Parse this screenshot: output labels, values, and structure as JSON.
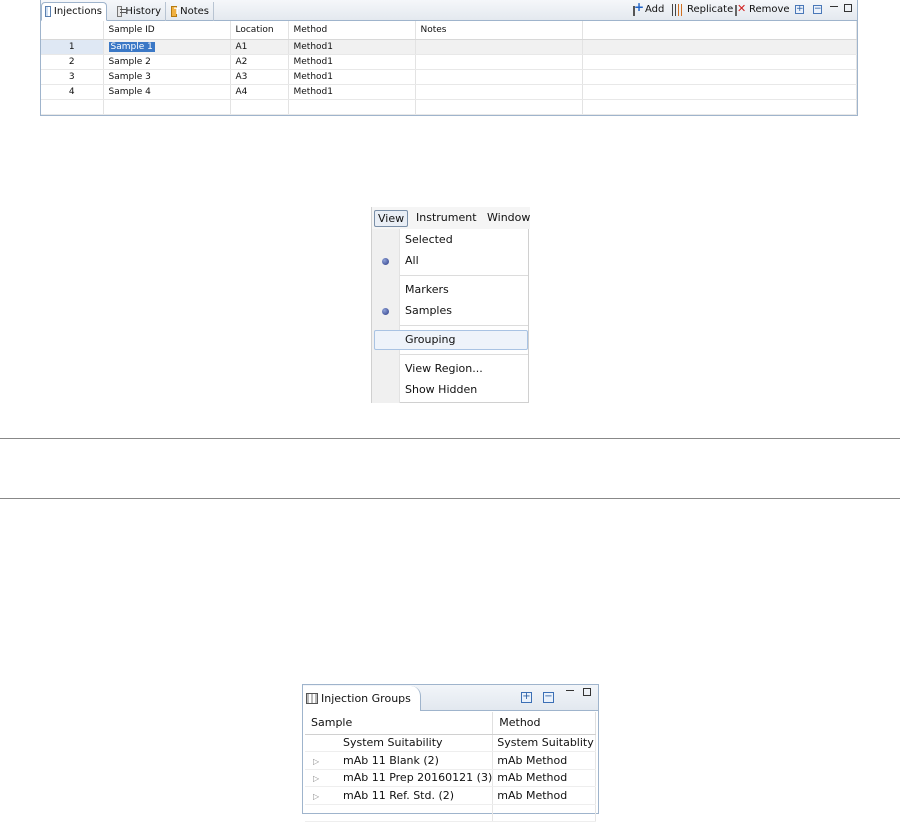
{
  "injections_panel": {
    "tabs": [
      {
        "label": "Injections",
        "icon": "table-icon"
      },
      {
        "label": "History",
        "icon": "history-icon"
      },
      {
        "label": "Notes",
        "icon": "notes-icon"
      }
    ],
    "toolbar": {
      "add": "Add",
      "replicate": "Replicate",
      "remove": "Remove",
      "expand": "+",
      "collapse": "−"
    },
    "columns": [
      "",
      "Sample ID",
      "Location",
      "Method",
      "Notes"
    ],
    "rows": [
      {
        "num": "1",
        "sample_id": "Sample 1",
        "location": "A1",
        "method": "Method1",
        "notes": ""
      },
      {
        "num": "2",
        "sample_id": "Sample 2",
        "location": "A2",
        "method": "Method1",
        "notes": ""
      },
      {
        "num": "3",
        "sample_id": "Sample 3",
        "location": "A3",
        "method": "Method1",
        "notes": ""
      },
      {
        "num": "4",
        "sample_id": "Sample 4",
        "location": "A4",
        "method": "Method1",
        "notes": ""
      }
    ]
  },
  "view_menu": {
    "menubar": [
      "View",
      "Instrument",
      "Window"
    ],
    "items": {
      "selected": "Selected",
      "all": "All",
      "markers": "Markers",
      "samples": "Samples",
      "grouping": "Grouping",
      "view_region": "View Region...",
      "show_hidden": "Show Hidden"
    }
  },
  "injection_groups_panel": {
    "title": "Injection Groups",
    "expand": "+",
    "collapse": "−",
    "columns": [
      "Sample",
      "Method"
    ],
    "rows": [
      {
        "expander": "",
        "sample": "System Suitability",
        "method": "System Suitablity"
      },
      {
        "expander": "▷",
        "sample": "mAb 11 Blank (2)",
        "method": "mAb Method"
      },
      {
        "expander": "▷",
        "sample": "mAb 11 Prep 20160121 (3)",
        "method": "mAb Method"
      },
      {
        "expander": "▷",
        "sample": "mAb 11 Ref. Std. (2)",
        "method": "mAb Method"
      }
    ]
  },
  "colors": {
    "selection": "#3b78c6",
    "panel_border": "#9fb4cc",
    "radio_dot": "#2a3a86"
  }
}
